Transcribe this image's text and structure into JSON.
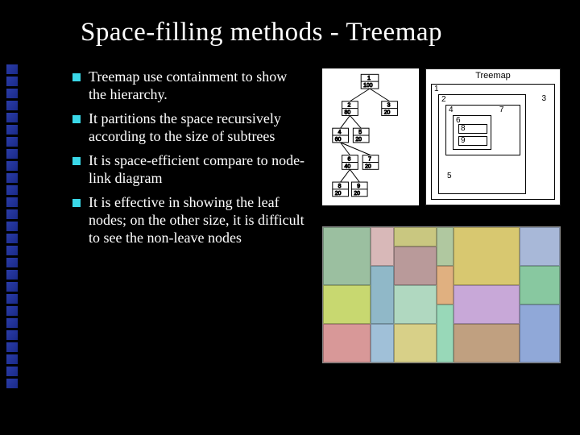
{
  "title": "Space-filling methods - Treemap",
  "bullets": [
    "Treemap use containment to show the hierarchy.",
    "It partitions the space recursively according to the size of subtrees",
    "It is space-efficient compare to node-link diagram",
    "It is effective in showing the leaf nodes; on the other size, it is difficult to see the non-leave nodes"
  ],
  "tree_nodes": {
    "n1": "1",
    "v1": "100",
    "n2": "2",
    "v2": "80",
    "n3": "3",
    "v3": "20",
    "n4": "4",
    "v4": "60",
    "n5": "5",
    "v5": "20",
    "n6": "6",
    "v6": "40",
    "n7": "7",
    "v7": "20",
    "n8": "8",
    "v8": "20",
    "n9": "9",
    "v9": "20"
  },
  "boxmap": {
    "title": "Treemap",
    "l1": "1",
    "l2": "2",
    "l3": "3",
    "l4": "4",
    "l5": "5",
    "l6": "6",
    "l7": "7",
    "l8": "8",
    "l9": "9"
  }
}
